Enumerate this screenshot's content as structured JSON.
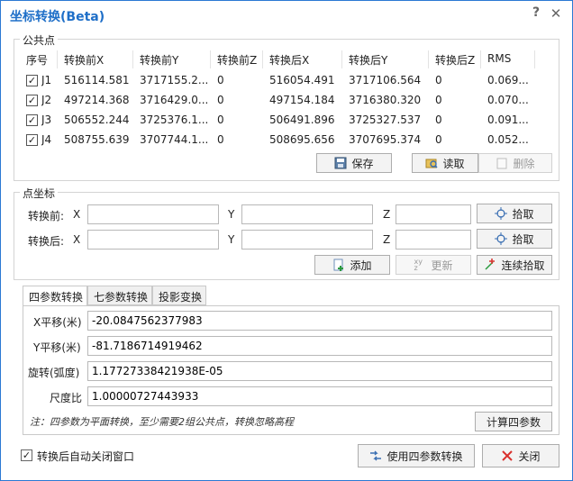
{
  "window": {
    "title": "坐标转换(Beta)",
    "help_glyph": "?",
    "close_glyph": "✕"
  },
  "common_points": {
    "group_title": "公共点",
    "columns": [
      "序号",
      "转换前X",
      "转换前Y",
      "转换前Z",
      "转换后X",
      "转换后Y",
      "转换后Z",
      "RMS"
    ],
    "rows": [
      {
        "id": "J1",
        "checked": true,
        "bx": "516114.581",
        "by": "3717155.2...",
        "bz": "0",
        "ax": "516054.491",
        "ay": "3717106.564",
        "az": "0",
        "rms": "0.069..."
      },
      {
        "id": "J2",
        "checked": true,
        "bx": "497214.368",
        "by": "3716429.0...",
        "bz": "0",
        "ax": "497154.184",
        "ay": "3716380.320",
        "az": "0",
        "rms": "0.070..."
      },
      {
        "id": "J3",
        "checked": true,
        "bx": "506552.244",
        "by": "3725376.1...",
        "bz": "0",
        "ax": "506491.896",
        "ay": "3725327.537",
        "az": "0",
        "rms": "0.091..."
      },
      {
        "id": "J4",
        "checked": true,
        "bx": "508755.639",
        "by": "3707744.1...",
        "bz": "0",
        "ax": "508695.656",
        "ay": "3707695.374",
        "az": "0",
        "rms": "0.052..."
      }
    ],
    "check_glyph": "✓",
    "save_label": "保存",
    "read_label": "读取",
    "delete_label": "删除"
  },
  "point_coords": {
    "group_title": "点坐标",
    "before_label": "转换前:",
    "after_label": "转换后:",
    "x_label": "X",
    "y_label": "Y",
    "z_label": "Z",
    "before_x": "",
    "before_y": "",
    "before_z": "",
    "after_x": "",
    "after_y": "",
    "after_z": "",
    "pick_label": "拾取",
    "add_label": "添加",
    "update_label": "更新",
    "continuous_pick_label": "连续拾取"
  },
  "tabs": [
    {
      "label": "四参数转换",
      "active": true
    },
    {
      "label": "七参数转换",
      "active": false
    },
    {
      "label": "投影变换",
      "active": false
    }
  ],
  "four_param": {
    "x_shift_label": "X平移(米)",
    "x_shift_value": "-20.0847562377983",
    "y_shift_label": "Y平移(米)",
    "y_shift_value": "-81.7186714919462",
    "rotation_label": "旋转(弧度)",
    "rotation_value": "1.17727338421938E-05",
    "scale_label": "尺度比",
    "scale_value": "1.00000727443933",
    "note": "注：四参数为平面转换，至少需要2组公共点，转换忽略高程",
    "calc_label": "计算四参数"
  },
  "footer": {
    "auto_close_checked": true,
    "auto_close_label": "转换后自动关闭窗口",
    "use_label": "使用四参数转换",
    "close_label": "关闭"
  },
  "colors": {
    "accent": "#1f6fc8",
    "close_red": "#d9302c"
  }
}
